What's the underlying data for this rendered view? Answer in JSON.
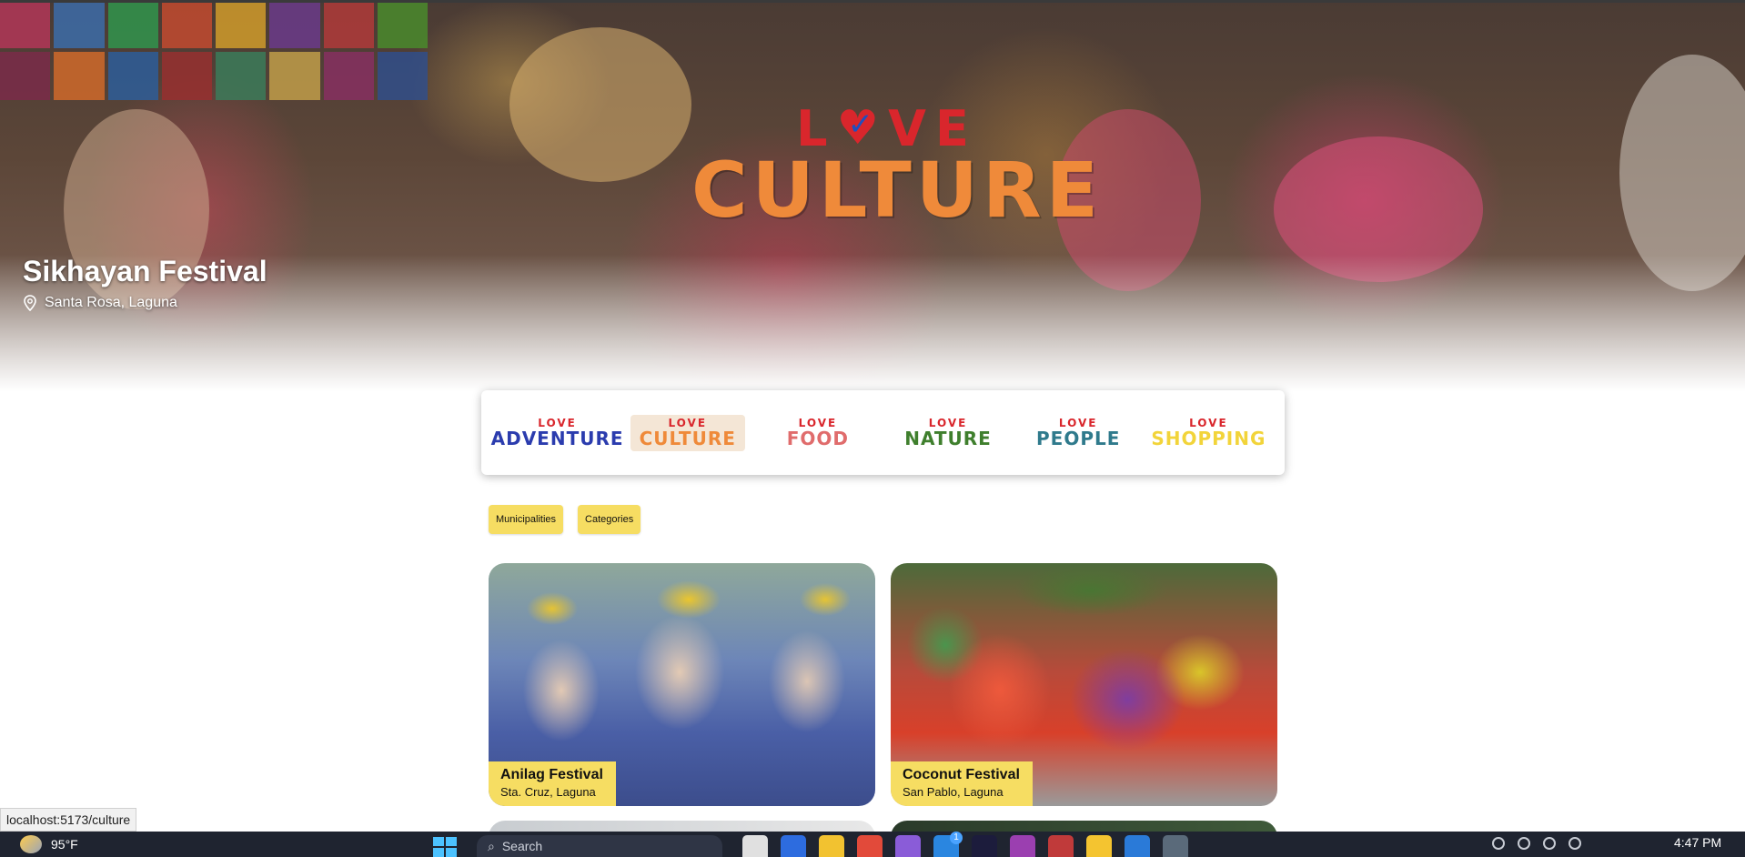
{
  "hero": {
    "title": "Sikhayan Festival",
    "location": "Santa Rosa, Laguna",
    "logo_top": "LOVE",
    "logo_main": "CULTURE"
  },
  "categories": [
    {
      "love": "LOVE",
      "word": "ADVENTURE",
      "color": "#2b3cae",
      "active": false
    },
    {
      "love": "LOVE",
      "word": "CULTURE",
      "color": "#ef8a3a",
      "active": true
    },
    {
      "love": "LOVE",
      "word": "FOOD",
      "color": "#e06c6c",
      "active": false
    },
    {
      "love": "LOVE",
      "word": "NATURE",
      "color": "#3f7f2d",
      "active": false
    },
    {
      "love": "LOVE",
      "word": "PEOPLE",
      "color": "#2f7a8c",
      "active": false
    },
    {
      "love": "LOVE",
      "word": "SHOPPING",
      "color": "#f2d43a",
      "active": false
    }
  ],
  "filters": {
    "municipalities": "Municipalities",
    "categories": "Categories"
  },
  "cards": [
    {
      "title": "Anilag Festival",
      "location": "Sta. Cruz, Laguna"
    },
    {
      "title": "Coconut Festival",
      "location": "San Pablo, Laguna"
    }
  ],
  "status_bar": {
    "url": "localhost:5173/culture"
  },
  "taskbar": {
    "temperature": "95°F",
    "search_placeholder": "Search",
    "time": "4:47 PM",
    "badge": "1"
  }
}
